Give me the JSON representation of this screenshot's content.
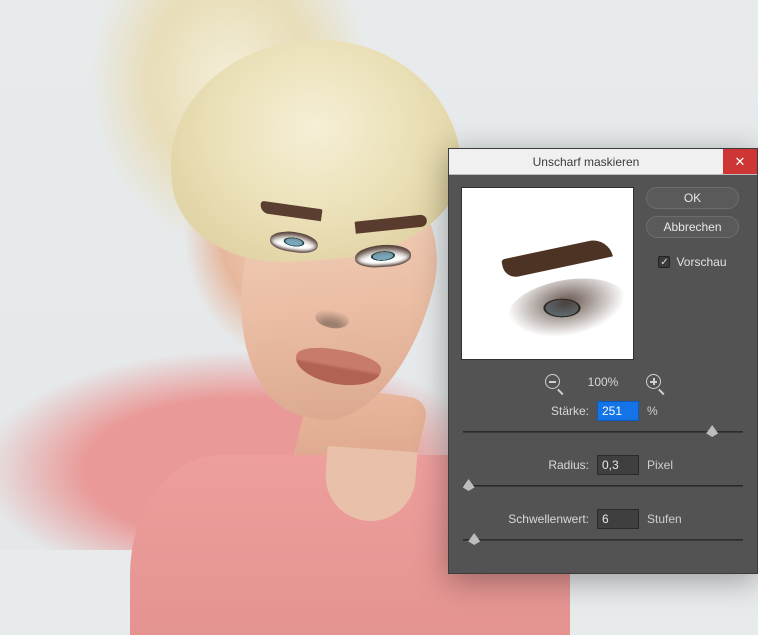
{
  "dialog": {
    "title": "Unscharf maskieren",
    "buttons": {
      "ok": "OK",
      "cancel": "Abbrechen"
    },
    "preview_checkbox": {
      "label": "Vorschau",
      "checked": true
    },
    "zoom": {
      "level": "100%"
    },
    "controls": {
      "amount": {
        "label": "Stärke:",
        "value": "251",
        "unit": "%",
        "slider_pct": 89
      },
      "radius": {
        "label": "Radius:",
        "value": "0,3",
        "unit": "Pixel",
        "slider_pct": 2
      },
      "threshold": {
        "label": "Schwellenwert:",
        "value": "6",
        "unit": "Stufen",
        "slider_pct": 4
      }
    }
  }
}
